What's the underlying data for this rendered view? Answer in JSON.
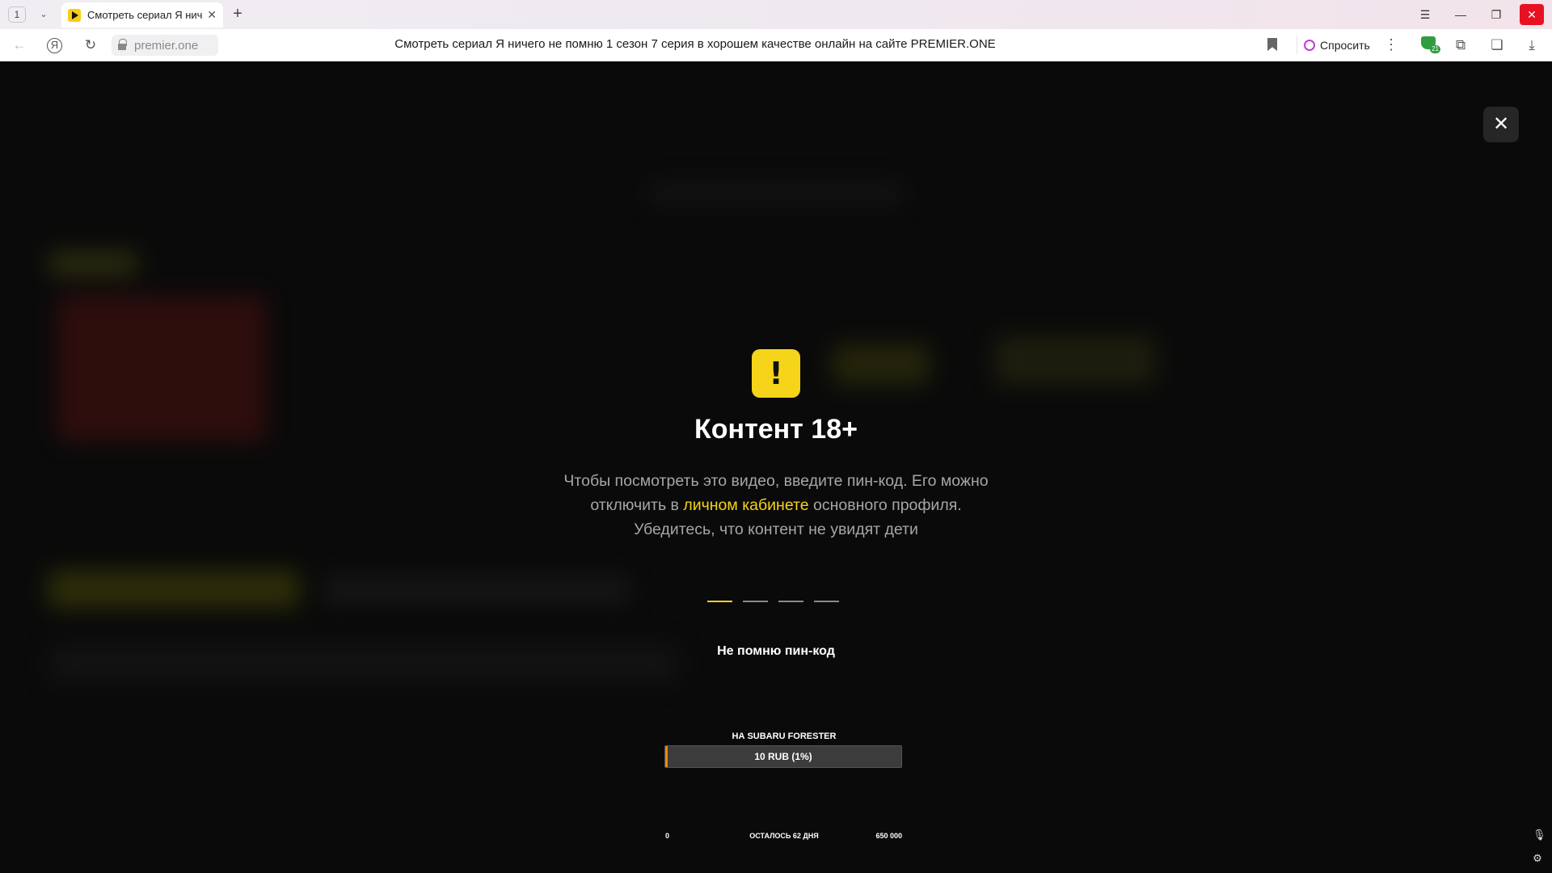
{
  "browser": {
    "tab_count": "1",
    "tab_title": "Смотреть сериал Я ничего не помню",
    "new_tab_symbol": "+",
    "url": "premier.one",
    "page_title": "Смотреть сериал Я ничего не помню 1 сезон 7 серия в хорошем качестве онлайн на сайте PREMIER.ONE",
    "ask_label": "Спросить",
    "extension_badge": "21"
  },
  "modal": {
    "close_symbol": "✕",
    "warning_symbol": "!",
    "title": "Контент 18+",
    "desc_line1": "Чтобы посмотреть это видео, введите пин-код. Его можно",
    "desc_line2_pre": "отключить в ",
    "desc_link": "личном кабинете",
    "desc_line2_post": " основного профиля.",
    "desc_line3": "Убедитесь, что контент не увидят дети",
    "pin_digits": 4,
    "pin_active_index": 0,
    "forgot_label": "Не помню пин-код"
  },
  "donation": {
    "title": "НА SUBARU FORESTER",
    "bar_label": "10 RUB (1%)",
    "progress_fraction": 0.01,
    "min_label": "0",
    "remaining_label": "ОСТАЛОСЬ 62 ДНЯ",
    "max_label": "650 000"
  },
  "colors": {
    "accent_yellow": "#f5d419",
    "progress_orange": "#f08a00",
    "close_red": "#e81123"
  },
  "icons": {
    "close": "close-icon",
    "warning": "exclamation-icon",
    "mic": "microphone-icon",
    "settings": "settings-icon"
  }
}
